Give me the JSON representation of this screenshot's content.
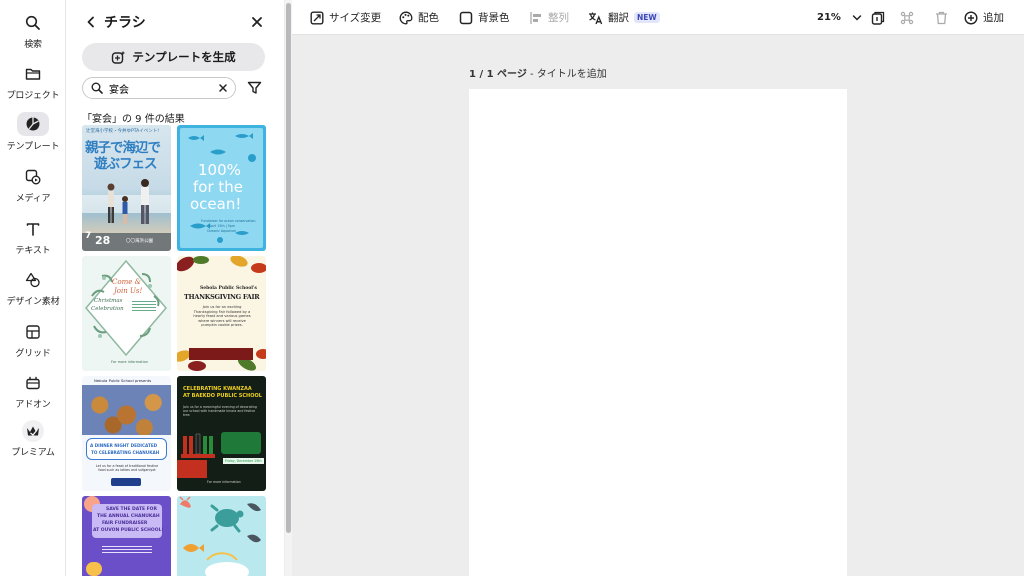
{
  "rail": {
    "items": [
      {
        "label": "検索",
        "icon": "search-icon"
      },
      {
        "label": "プロジェクト",
        "icon": "folder-icon"
      },
      {
        "label": "テンプレート",
        "icon": "template-icon",
        "active": true
      },
      {
        "label": "メディア",
        "icon": "media-icon"
      },
      {
        "label": "テキスト",
        "icon": "text-icon"
      },
      {
        "label": "デザイン素材",
        "icon": "shapes-icon"
      },
      {
        "label": "グリッド",
        "icon": "grid-icon"
      },
      {
        "label": "アドオン",
        "icon": "addon-icon"
      },
      {
        "label": "プレミアム",
        "icon": "premium-crown-icon"
      }
    ]
  },
  "panel": {
    "title": "チラシ",
    "generate_label": "テンプレートを生成",
    "search_value": "宴会",
    "result_text": "「宴会」の 9 件の結果"
  },
  "templates": {
    "t1": {
      "top": "辻堂海小学校・今井ゆPTAイベント!",
      "h1": "親子で海辺で",
      "h2": "遊ぶフェス",
      "date": "7",
      "day": "28",
      "bottom": "〇〇海浜公園"
    },
    "t2": {
      "l1": "100%",
      "l2": "for the",
      "l3": "ocean!",
      "small1": "Fundraiser for ocean conservation",
      "small2": "April 15th | 5pm",
      "small3": "Oceanic Aquarium"
    },
    "t3": {
      "l1": "Come &",
      "l2": "Join Us!",
      "l3": "Christmas",
      "l4": "Celebration",
      "bottom": "For more information"
    },
    "t4": {
      "l1": "Sebola Public School's",
      "l2": "THANKSGIVING FAIR",
      "body": "Join us for an exciting Thanksgiving Fair followed by a hearty feast and various games where winners will receive pumpkin cookie prizes."
    },
    "t5": {
      "top": "Nebula Public School presents",
      "l1": "A DINNER NIGHT DEDICATED",
      "l2": "TO CELEBRATING CHANUKAH",
      "body": "Let us for a feast of traditional festive food such as latkes and sufganiyot"
    },
    "t6": {
      "l1": "CELEBRATING KWANZAA",
      "l2": "AT BAEKDO PUBLIC SCHOOL",
      "body": "Join us for a meaningful evening of decorating our school with handmade kinara and festive tree.",
      "date": "Friday, December 19th",
      "bottom": "For more information"
    },
    "t7": {
      "l1": "SAVE THE DATE FOR",
      "l2": "THE ANNUAL CHANUKAH",
      "l3": "FAIR FUNDRAISER",
      "l4": "AT OUVON PUBLIC SCHOOL!"
    }
  },
  "toolbar": {
    "resize": "サイズ変更",
    "color": "配色",
    "background": "背景色",
    "align": "整列",
    "translate": "翻訳",
    "new_badge": "NEW",
    "zoom": "21%",
    "add": "追加"
  },
  "canvas": {
    "page_label": "1 / 1 ページ",
    "page_title_suffix": " - タイトルを追加"
  }
}
